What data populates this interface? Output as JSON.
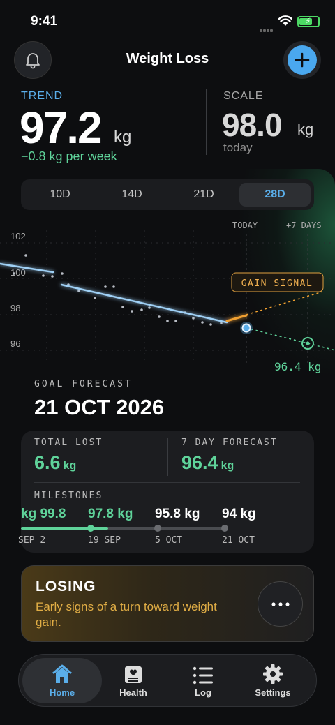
{
  "status_bar": {
    "time": "9:41"
  },
  "header": {
    "title": "Weight Loss",
    "left_icon": "bell-icon",
    "right_icon": "plus-icon"
  },
  "trend": {
    "label": "TREND",
    "value": "97.2",
    "unit": "kg",
    "rate": "−0.8 kg per week"
  },
  "scale": {
    "label": "SCALE",
    "value": "98.0",
    "unit": "kg",
    "sub": "today"
  },
  "range_tabs": [
    {
      "label": "10D",
      "active": false
    },
    {
      "label": "14D",
      "active": false
    },
    {
      "label": "21D",
      "active": false
    },
    {
      "label": "28D",
      "active": true
    }
  ],
  "chart_data": {
    "type": "line",
    "y_ticks": [
      "102",
      "100",
      "98",
      "96"
    ],
    "ylim": [
      95.5,
      102.5
    ],
    "annotations": {
      "today": "TODAY",
      "plus7": "+7 DAYS",
      "signal": "GAIN SIGNAL",
      "forecast_label": "96.4 kg"
    },
    "forecast_value": 96.4,
    "colors": {
      "trend": "#9fd0f5",
      "forecast": "#5fd39a",
      "signal": "#f0a030"
    }
  },
  "goal": {
    "label": "GOAL FORECAST",
    "date": "21 OCT 2026"
  },
  "stats": {
    "total_lost_label": "TOTAL LOST",
    "total_lost_value": "6.6",
    "total_lost_unit": "kg",
    "forecast_label": "7 DAY FORECAST",
    "forecast_value": "96.4",
    "forecast_unit": "kg",
    "milestones_label": "MILESTONES",
    "milestones": [
      {
        "value": "99.8 kg",
        "date": "2 SEP",
        "done": true
      },
      {
        "value": "97.8 kg",
        "date": "19 SEP",
        "done": true
      },
      {
        "value": "95.8 kg",
        "date": "5 OCT",
        "done": false
      },
      {
        "value": "94 kg",
        "date": "21 OCT",
        "done": false
      }
    ]
  },
  "alert": {
    "title": "LOSING",
    "body": "Early signs of a turn toward weight gain."
  },
  "tabs": [
    {
      "label": "Home",
      "icon": "house-icon",
      "active": true
    },
    {
      "label": "Health",
      "icon": "health-record-icon",
      "active": false
    },
    {
      "label": "Log",
      "icon": "list-icon",
      "active": false
    },
    {
      "label": "Settings",
      "icon": "gear-icon",
      "active": false
    }
  ]
}
